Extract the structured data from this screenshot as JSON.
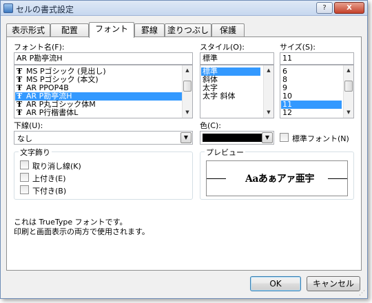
{
  "window": {
    "title": "セルの書式設定",
    "help_label": "?",
    "close_label": "X"
  },
  "tabs": [
    {
      "label": "表示形式",
      "active": false
    },
    {
      "label": "配置",
      "active": false
    },
    {
      "label": "フォント",
      "active": true
    },
    {
      "label": "罫線",
      "active": false
    },
    {
      "label": "塗りつぶし",
      "active": false
    },
    {
      "label": "保護",
      "active": false
    }
  ],
  "font": {
    "label": "フォント名(F):",
    "value": "AR P勘亭流H",
    "items": [
      {
        "text": "MS Pゴシック (見出し)",
        "selected": false
      },
      {
        "text": "MS Pゴシック (本文)",
        "selected": false
      },
      {
        "text": "AR PPOP4B",
        "selected": false
      },
      {
        "text": "AR P勘亭流H",
        "selected": true
      },
      {
        "text": "AR P丸ゴシック体M",
        "selected": false
      },
      {
        "text": "AR P行楷書体L",
        "selected": false
      }
    ],
    "truetype_glyph": "Ŧ"
  },
  "style": {
    "label": "スタイル(O):",
    "value": "標準",
    "items": [
      {
        "text": "標準",
        "selected": true
      },
      {
        "text": "斜体",
        "selected": false
      },
      {
        "text": "太字",
        "selected": false
      },
      {
        "text": "太字 斜体",
        "selected": false
      }
    ]
  },
  "size": {
    "label": "サイズ(S):",
    "value": "11",
    "items": [
      {
        "text": "6",
        "selected": false
      },
      {
        "text": "8",
        "selected": false
      },
      {
        "text": "9",
        "selected": false
      },
      {
        "text": "10",
        "selected": false
      },
      {
        "text": "11",
        "selected": true
      },
      {
        "text": "12",
        "selected": false
      }
    ]
  },
  "underline": {
    "label": "下線(U):",
    "value": "なし"
  },
  "color": {
    "label": "色(C):",
    "value_hex": "#000000",
    "normal_font_label": "標準フォント(N)"
  },
  "effects": {
    "legend": "文字飾り",
    "strikethrough": "取り消し線(K)",
    "superscript": "上付き(E)",
    "subscript": "下付き(B)"
  },
  "preview": {
    "legend": "プレビュー",
    "sample": "Aaあぁアァ亜宇"
  },
  "info": {
    "line1": "これは TrueType フォントです。",
    "line2": "印刷と画面表示の両方で使用されます。"
  },
  "buttons": {
    "ok": "OK",
    "cancel": "キャンセル"
  },
  "scroll_arrows": {
    "up": "▲",
    "down": "▼"
  },
  "colors": {
    "selection": "#3399ff",
    "titlebar_top": "#dfe9f6",
    "close_button": "#c4412b"
  }
}
